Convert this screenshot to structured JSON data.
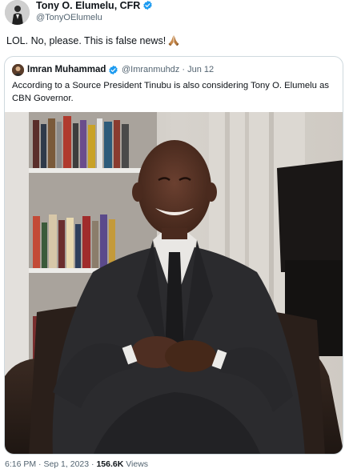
{
  "author": {
    "name": "Tony O. Elumelu, CFR",
    "handle": "@TonyOElumelu",
    "avatar_icon": "profile-photo"
  },
  "tweet": {
    "text": "LOL. No, please. This is false news!",
    "emoji_icon": "folded-hands-icon"
  },
  "quote": {
    "name": "Imran Muhammad",
    "handle": "@Imranmuhdz",
    "separator": "·",
    "date": "Jun 12",
    "text": "According to a Source President Tinubu is also considering Tony O. Elumelu as CBN Governor.",
    "photo_icon": "man-seated-in-suit-photo"
  },
  "footer": {
    "time": "6:16 PM",
    "separator1": "·",
    "date": "Sep 1, 2023",
    "separator2": "·",
    "views_count": "156.6K",
    "views_label": "Views"
  },
  "colors": {
    "verified": "#1d9bf0",
    "secondary_text": "#536471",
    "border": "#cfd9de"
  }
}
